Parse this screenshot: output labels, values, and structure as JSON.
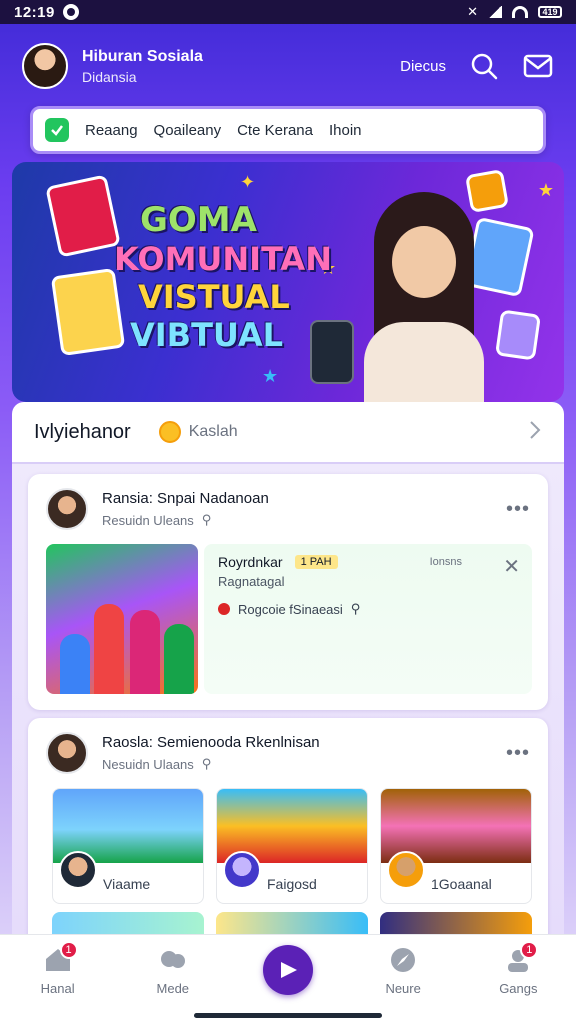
{
  "status_bar": {
    "time": "12:19",
    "battery": "419"
  },
  "header": {
    "title": "Hiburan Sosiala",
    "subtitle": "Didansia",
    "action_label": "Diecus"
  },
  "search_bar": {
    "chips": [
      "Reaang",
      "Qoaileany",
      "Cte Kerana",
      "Ihoin"
    ]
  },
  "banner": {
    "line1": "GOMA",
    "line2": "KOMUNITAN",
    "line3": "VISTUAL",
    "line4": "VIBTUAL"
  },
  "section": {
    "title": "Ivlyiehanor",
    "tag": "Kaslah"
  },
  "post1": {
    "author": "Ransia: Snpai Nadanoan",
    "meta": "Resuidn Uleans",
    "card_title": "Royrdnkar",
    "card_badge": "1 PAH",
    "card_subtitle": "Ragnatagal",
    "card_aux": "Ionsns",
    "card_line": "Rogcoie fSinaeasi"
  },
  "post2": {
    "author": "Raosla: Semienooda Rkenlnisan",
    "meta": "Nesuidn Ulaans",
    "thumbs": [
      {
        "label": "Viaame"
      },
      {
        "label": "Faigosd"
      },
      {
        "label": "1Goaanal"
      }
    ]
  },
  "nav": {
    "items": [
      {
        "label": "Hanal",
        "badge": "1"
      },
      {
        "label": "Mede"
      },
      {
        "label": ""
      },
      {
        "label": "Neure"
      },
      {
        "label": "Gangs",
        "badge": "1"
      }
    ]
  },
  "colors": {
    "accent": "#5b21b6",
    "primary_gradient_start": "#3f2ad6",
    "badge": "#e11d48",
    "check": "#22c55e"
  },
  "icons": [
    "search-icon",
    "mail-icon",
    "check-icon",
    "chevron-right-icon",
    "more-icon",
    "close-icon",
    "home-icon",
    "media-icon",
    "play-icon",
    "compass-icon",
    "people-icon"
  ]
}
